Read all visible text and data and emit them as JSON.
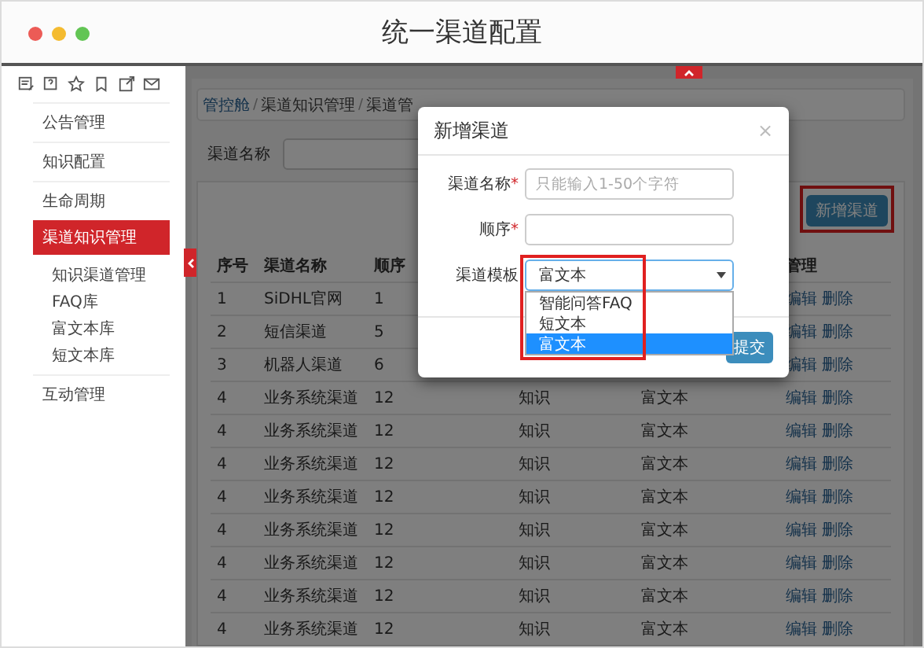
{
  "window": {
    "title": "统一渠道配置"
  },
  "sidebar": {
    "items": [
      {
        "label": "公告管理",
        "selected": false
      },
      {
        "label": "知识配置",
        "selected": false
      },
      {
        "label": "生命周期",
        "selected": false
      },
      {
        "label": "渠道知识管理",
        "selected": true,
        "children": [
          {
            "label": "知识渠道管理"
          },
          {
            "label": "FAQ库"
          },
          {
            "label": "富文本库"
          },
          {
            "label": "短文本库"
          }
        ]
      },
      {
        "label": "互动管理",
        "selected": false
      }
    ]
  },
  "breadcrumb": {
    "items": [
      "管控舱",
      "渠道知识管理",
      "渠道管"
    ],
    "separators": [
      "/",
      "/"
    ]
  },
  "search": {
    "label": "渠道名称"
  },
  "add_button": {
    "label": "新增渠道",
    "highlighted": true
  },
  "table": {
    "headers": {
      "no": "序号",
      "name": "渠道名称",
      "order": "顺序",
      "actions": "管理"
    },
    "rows": [
      {
        "no": "1",
        "name": "SiDHL官网",
        "order": "1",
        "actions": [
          "编辑",
          "删除"
        ]
      },
      {
        "no": "2",
        "name": "短信渠道",
        "order": "5",
        "actions": [
          "编辑",
          "删除"
        ]
      },
      {
        "no": "3",
        "name": "机器人渠道",
        "order": "6",
        "actions": [
          "编辑",
          "删除"
        ]
      },
      {
        "no": "4",
        "name": "业务系统渠道",
        "order": "12",
        "type": "知识",
        "template": "富文本",
        "actions": [
          "编辑",
          "删除"
        ]
      },
      {
        "no": "4",
        "name": "业务系统渠道",
        "order": "12",
        "type": "知识",
        "template": "富文本",
        "actions": [
          "编辑",
          "删除"
        ]
      },
      {
        "no": "4",
        "name": "业务系统渠道",
        "order": "12",
        "type": "知识",
        "template": "富文本",
        "actions": [
          "编辑",
          "删除"
        ]
      },
      {
        "no": "4",
        "name": "业务系统渠道",
        "order": "12",
        "type": "知识",
        "template": "富文本",
        "actions": [
          "编辑",
          "删除"
        ]
      },
      {
        "no": "4",
        "name": "业务系统渠道",
        "order": "12",
        "type": "知识",
        "template": "富文本",
        "actions": [
          "编辑",
          "删除"
        ]
      },
      {
        "no": "4",
        "name": "业务系统渠道",
        "order": "12",
        "type": "知识",
        "template": "富文本",
        "actions": [
          "编辑",
          "删除"
        ]
      },
      {
        "no": "4",
        "name": "业务系统渠道",
        "order": "12",
        "type": "知识",
        "template": "富文本",
        "actions": [
          "编辑",
          "删除"
        ]
      },
      {
        "no": "4",
        "name": "业务系统渠道",
        "order": "12",
        "type": "知识",
        "template": "富文本",
        "actions": [
          "编辑",
          "删除"
        ]
      }
    ]
  },
  "modal": {
    "title": "新增渠道",
    "close": "×",
    "fields": [
      {
        "kind": "text",
        "label": "渠道名称",
        "required_mark": "*",
        "placeholder": "只能输入1-50个字符"
      },
      {
        "kind": "text",
        "label": "顺序",
        "required_mark": "*"
      },
      {
        "kind": "select",
        "label": "渠道模板",
        "value": "富文本",
        "expanded": true,
        "highlighted": true,
        "options": [
          {
            "label": "智能问答FAQ",
            "selected": false
          },
          {
            "label": "短文本",
            "selected": false
          },
          {
            "label": "富文本",
            "selected": true
          }
        ]
      }
    ],
    "submit": "提交"
  }
}
